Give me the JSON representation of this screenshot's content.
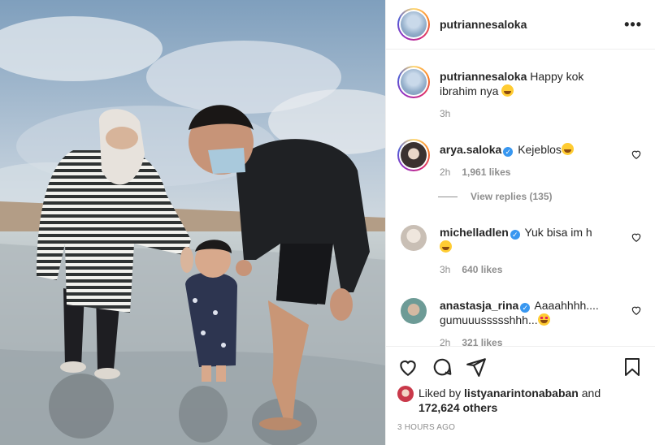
{
  "post": {
    "author": "putriannesaloka",
    "more_icon": "more-horizontal-icon"
  },
  "caption": {
    "username": "putriannesaloka",
    "text": "Happy kok ibrahim nya",
    "time": "3h"
  },
  "comments": [
    {
      "username": "arya.saloka",
      "verified": true,
      "text": "Kejeblos",
      "time": "2h",
      "likes": "1,961 likes",
      "view_replies": "View replies (135)"
    },
    {
      "username": "michelladlen",
      "verified": true,
      "text": "Yuk bisa im h",
      "time": "3h",
      "likes": "640 likes"
    },
    {
      "username": "anastasja_rina",
      "verified": true,
      "text": "Aaaahhhh.... gumuuussssshhh...",
      "time": "2h",
      "likes": "321 likes"
    }
  ],
  "actions": {
    "liked_by_prefix": "Liked by",
    "liked_by_user": "listyanarintonababan",
    "liked_by_and": "and",
    "liked_by_count": "172,624 others",
    "timestamp": "3 HOURS AGO"
  },
  "colors": {
    "verified": "#3897f0",
    "meta": "#8e8e8e",
    "text": "#262626"
  }
}
